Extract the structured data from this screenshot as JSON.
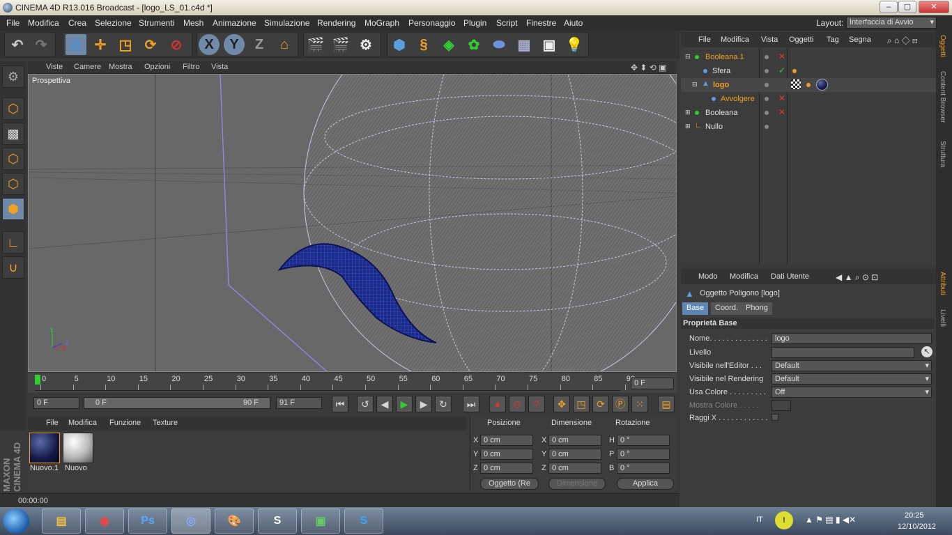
{
  "window": {
    "title": "CINEMA 4D R13.016 Broadcast - [logo_LS_01.c4d *]"
  },
  "menu": {
    "items": [
      "File",
      "Modifica",
      "Crea",
      "Selezione",
      "Strumenti",
      "Mesh",
      "Animazione",
      "Simulazione",
      "Rendering",
      "MoGraph",
      "Personaggio",
      "Plugin",
      "Script",
      "Finestre",
      "Aiuto"
    ],
    "layout_label": "Layout:",
    "layout_value": "Interfaccia di Avvio"
  },
  "toolbar": {
    "axis_x": "X",
    "axis_y": "Y",
    "axis_z": "Z"
  },
  "viewport": {
    "menu": [
      "Viste",
      "Camere",
      "Mostra",
      "Opzioni",
      "Filtro",
      "Vista"
    ],
    "label": "Prospettiva",
    "gizmo_y": "Y",
    "gizmo_x": "X",
    "gizmo_z": "Z"
  },
  "timeline": {
    "ticks": [
      "0",
      "5",
      "10",
      "15",
      "20",
      "25",
      "30",
      "35",
      "40",
      "45",
      "50",
      "55",
      "60",
      "65",
      "70",
      "75",
      "80",
      "85",
      "90"
    ],
    "current_frame": "0 F",
    "start_frame": "0 F",
    "range_start": "0 F",
    "range_end": "90 F",
    "end_frame": "91 F"
  },
  "materials": {
    "menu": [
      "File",
      "Modifica",
      "Funzione",
      "Texture"
    ],
    "items": [
      {
        "name": "Nuovo.1",
        "color": "#141a48"
      },
      {
        "name": "Nuovo",
        "color": "#b8b8b8"
      }
    ]
  },
  "coordinates": {
    "headers": [
      "Posizione",
      "Dimensione",
      "Rotazione"
    ],
    "pos": [
      {
        "axis": "X",
        "value": "0 cm"
      },
      {
        "axis": "Y",
        "value": "0 cm"
      },
      {
        "axis": "Z",
        "value": "0 cm"
      }
    ],
    "size": [
      {
        "axis": "X",
        "value": "0 cm"
      },
      {
        "axis": "Y",
        "value": "0 cm"
      },
      {
        "axis": "Z",
        "value": "0 cm"
      }
    ],
    "rot": [
      {
        "axis": "H",
        "value": "0 °"
      },
      {
        "axis": "P",
        "value": "0 °"
      },
      {
        "axis": "B",
        "value": "0 °"
      }
    ],
    "mode": "Oggetto (Re",
    "size_mode": "Dimensione",
    "apply": "Applica"
  },
  "status": {
    "time": "00:00:00"
  },
  "logo_text": "MAXON CINEMA 4D",
  "objects": {
    "menu": [
      "File",
      "Modifica",
      "Vista",
      "Oggetti",
      "Tag",
      "Segna"
    ],
    "rows": [
      {
        "name": "Booleana.1",
        "color": "#f0a020"
      },
      {
        "name": "Sfera",
        "color": "#e0e0e0"
      },
      {
        "name": "logo",
        "color": "#f0a020"
      },
      {
        "name": "Avvolgere",
        "color": "#f0a020"
      },
      {
        "name": "Booleana",
        "color": "#e0e0e0"
      },
      {
        "name": "Nullo",
        "color": "#e0e0e0"
      }
    ]
  },
  "attributes": {
    "menu": [
      "Modo",
      "Modifica",
      "Dati Utente"
    ],
    "object_title": "Oggetto Poligono [logo]",
    "tabs": [
      "Base",
      "Coord.",
      "Phong"
    ],
    "section": "Proprietà Base",
    "fields": [
      {
        "label": "Nome. . . . . . . . . . . . . .",
        "value": "logo"
      },
      {
        "label": "Livello",
        "value": ""
      },
      {
        "label": "Visibile nell'Editor . . .",
        "value": "Default"
      },
      {
        "label": "Visibile nel Rendering",
        "value": "Default"
      },
      {
        "label": "Usa Colore . . . . . . . . .",
        "value": "Off"
      },
      {
        "label": "Mostra Colore . . . . .",
        "value": ""
      },
      {
        "label": "Raggi X . . . . . . . . . . . .",
        "value": ""
      }
    ]
  },
  "side_tabs": [
    "Oggetti",
    "Content Browser",
    "Struttura",
    "Attributi",
    "Livelli"
  ],
  "taskbar": {
    "lang": "IT",
    "time": "20:25",
    "date": "12/10/2012"
  },
  "colors": {
    "accent": "#f0a020",
    "selection": "#5d86b4",
    "mesh": "#0e1450"
  }
}
